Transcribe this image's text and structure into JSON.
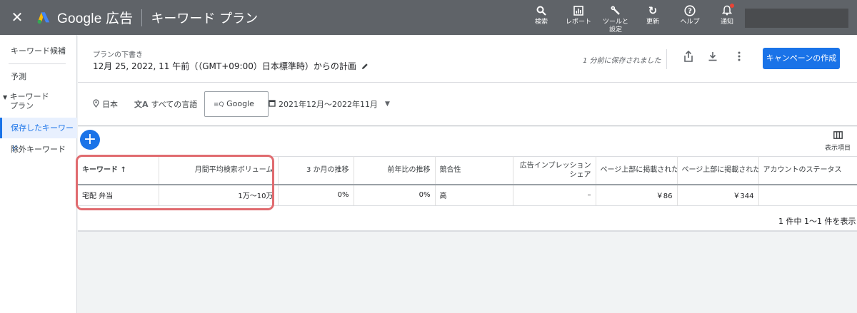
{
  "topbar": {
    "close_glyph": "✕",
    "brand": "Google 広告",
    "page_name": "キーワード プラン",
    "actions": [
      {
        "icon": "search-icon",
        "glyph": "🔍︎",
        "label": "検索"
      },
      {
        "icon": "report-icon",
        "glyph": "▥",
        "label": "レポート"
      },
      {
        "icon": "wrench-icon",
        "glyph": "🔧︎",
        "label": "ツールと",
        "label2": "設定"
      },
      {
        "icon": "refresh-icon",
        "glyph": "↻",
        "label": "更新"
      },
      {
        "icon": "help-icon",
        "glyph": "?",
        "label": "ヘルプ"
      },
      {
        "icon": "bell-icon",
        "glyph": "🔔︎",
        "label": "通知"
      }
    ],
    "colors": {
      "bar": "#5f6368",
      "notification_dot": "#ea4335"
    }
  },
  "sidebar": {
    "items": [
      {
        "label": "キーワード候補"
      },
      {
        "label": "予測"
      },
      {
        "label": "キーワード",
        "label2": "プラン"
      },
      {
        "label": "保存したキーワード",
        "active": true
      },
      {
        "label": "除外キーワード"
      }
    ]
  },
  "header": {
    "draft_label": "プランの下書き",
    "plan_title": "12月 25, 2022, 11 午前（（GMT+09:00）日本標準時）からの計画",
    "saved_text": "1 分前に保存されました",
    "create_campaign": "キャンペーンの作成",
    "accent": "#1a73e8"
  },
  "filters": {
    "location": "日本",
    "language": "すべての言語",
    "network": "Google",
    "date_range": "2021年12月～2022年11月"
  },
  "table": {
    "columns_label": "表示項目",
    "headers": [
      "キーワード ↑",
      "月間平均検索ボリューム",
      "3 か月の推移",
      "前年比の推移",
      "競合性",
      "広告インプレッション シェア",
      "ページ上部に掲載された!",
      "ページ上部に掲載された!",
      "アカウントのステータス"
    ],
    "rows": [
      [
        "宅配 弁当",
        "1万～10万",
        "0%",
        "0%",
        "高",
        "–",
        "￥86",
        "￥344",
        ""
      ]
    ],
    "pager": "1 件中 1～1 件を表示"
  }
}
